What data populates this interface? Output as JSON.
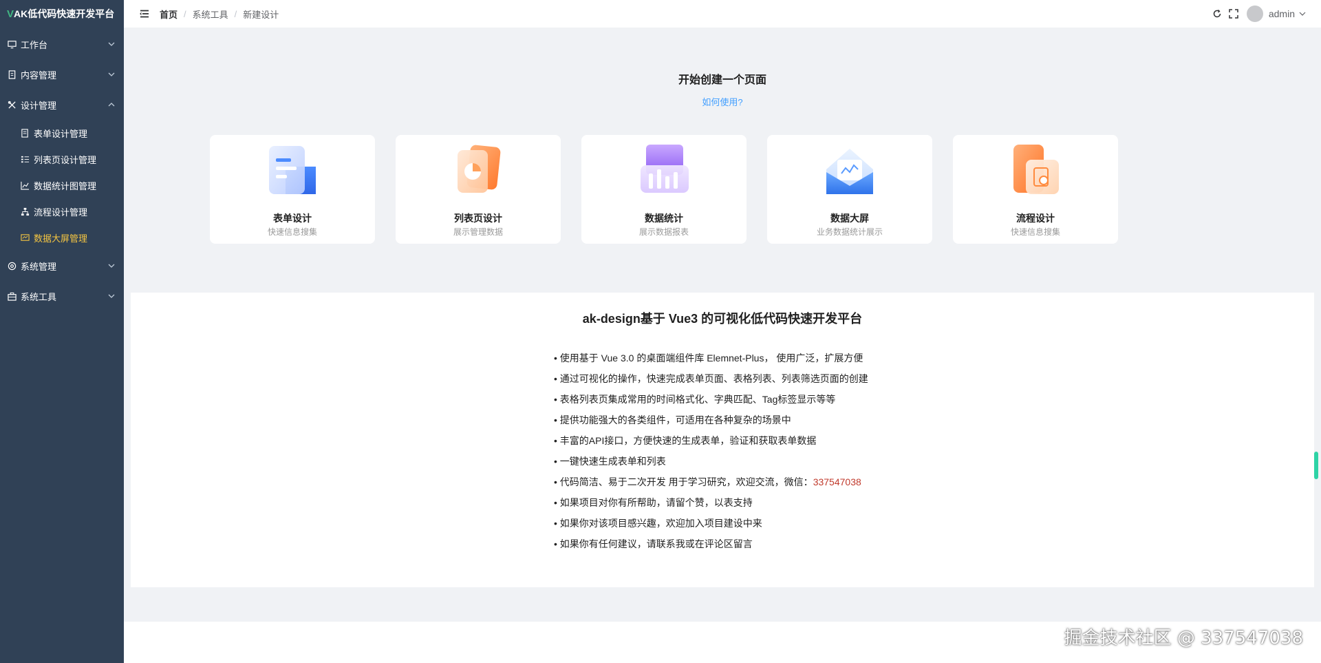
{
  "sidebar": {
    "logo_v": "V",
    "logo_text": "AK低代码快速开发平台",
    "groups": [
      {
        "label": "工作台"
      },
      {
        "label": "内容管理"
      },
      {
        "label": "设计管理"
      },
      {
        "label": "系统管理"
      },
      {
        "label": "系统工具"
      }
    ],
    "design_items": [
      {
        "label": "表单设计管理"
      },
      {
        "label": "列表页设计管理"
      },
      {
        "label": "数据统计图管理"
      },
      {
        "label": "流程设计管理"
      },
      {
        "label": "数据大屏管理"
      }
    ],
    "active_color": "#f4c542"
  },
  "header": {
    "breadcrumbs": [
      "首页",
      "系统工具",
      "新建设计"
    ],
    "separator": "/",
    "username": "admin"
  },
  "main": {
    "start_title": "开始创建一个页面",
    "how_link": "如何使用?",
    "cards": [
      {
        "title": "表单设计",
        "subtitle": "快速信息搜集"
      },
      {
        "title": "列表页设计",
        "subtitle": "展示管理数据"
      },
      {
        "title": "数据统计",
        "subtitle": "展示数据报表"
      },
      {
        "title": "数据大屏",
        "subtitle": "业务数据统计展示"
      },
      {
        "title": "流程设计",
        "subtitle": "快速信息搜集"
      }
    ]
  },
  "info": {
    "title": "ak-design基于 Vue3 的可视化低代码快速开发平台",
    "bullets": [
      "使用基于 Vue 3.0 的桌面端组件库 Elemnet-Plus， 使用广泛，扩展方便",
      "通过可视化的操作，快速完成表单页面、表格列表、列表筛选页面的创建",
      "表格列表页集成常用的时间格式化、字典匹配、Tag标签显示等等",
      "提供功能强大的各类组件，可适用在各种复杂的场景中",
      "丰富的API接口，方便快速的生成表单，验证和获取表单数据",
      "一键快速生成表单和列表",
      "代码简洁、易于二次开发 用于学习研究，欢迎交流，微信：",
      "如果项目对你有所帮助，请留个赞，以表支持",
      "如果你对该项目感兴趣，欢迎加入项目建设中来",
      "如果你有任何建议，请联系我或在评论区留言"
    ],
    "wechat_id": "337547038"
  },
  "watermark": "掘金技术社区 @ 337547038"
}
